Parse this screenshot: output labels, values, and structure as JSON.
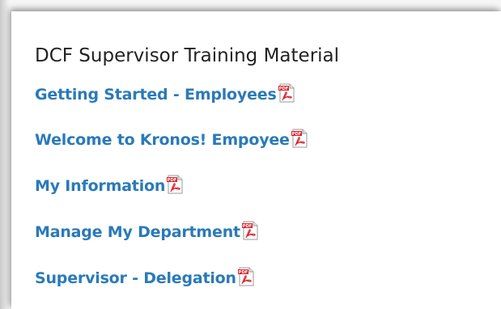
{
  "section": {
    "title": "DCF Supervisor Training Material"
  },
  "documents": [
    {
      "label": "Getting Started - Employees",
      "icon": "pdf-icon"
    },
    {
      "label": "Welcome to Kronos! Empoyee",
      "icon": "pdf-icon"
    },
    {
      "label": "My Information",
      "icon": "pdf-icon"
    },
    {
      "label": "Manage My Department",
      "icon": "pdf-icon"
    },
    {
      "label": "Supervisor - Delegation",
      "icon": "pdf-icon"
    }
  ],
  "colors": {
    "link": "#2a7ab9",
    "title": "#222222",
    "pdf_red": "#d9232a"
  }
}
